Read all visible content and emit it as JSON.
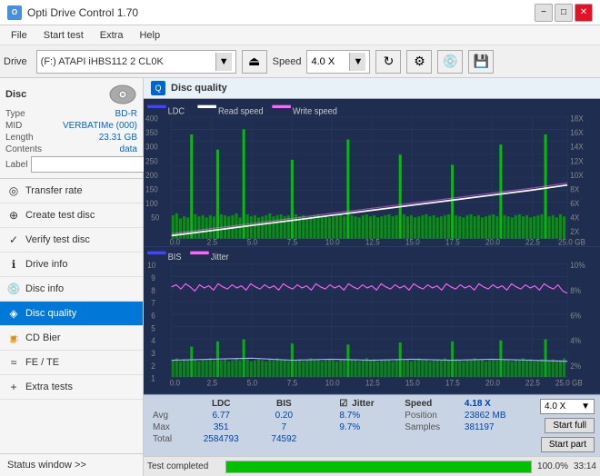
{
  "titleBar": {
    "title": "Opti Drive Control 1.70",
    "icon": "O",
    "minimizeLabel": "−",
    "maximizeLabel": "□",
    "closeLabel": "✕"
  },
  "menuBar": {
    "items": [
      "File",
      "Start test",
      "Extra",
      "Help"
    ]
  },
  "driveBar": {
    "driveLabel": "Drive",
    "driveValue": "(F:)  ATAPI iHBS112  2 CL0K",
    "speedLabel": "Speed",
    "speedValue": "4.0 X"
  },
  "disc": {
    "header": "Disc",
    "typeLabel": "Type",
    "typeValue": "BD-R",
    "midLabel": "MID",
    "midValue": "VERBATIMe (000)",
    "lengthLabel": "Length",
    "lengthValue": "23.31 GB",
    "contentsLabel": "Contents",
    "contentsValue": "data",
    "labelLabel": "Label",
    "labelValue": ""
  },
  "nav": {
    "items": [
      {
        "id": "transfer-rate",
        "label": "Transfer rate",
        "icon": "◎"
      },
      {
        "id": "create-test-disc",
        "label": "Create test disc",
        "icon": "⊕"
      },
      {
        "id": "verify-test-disc",
        "label": "Verify test disc",
        "icon": "✓"
      },
      {
        "id": "drive-info",
        "label": "Drive info",
        "icon": "ℹ"
      },
      {
        "id": "disc-info",
        "label": "Disc info",
        "icon": "💿"
      },
      {
        "id": "disc-quality",
        "label": "Disc quality",
        "icon": "◈",
        "active": true
      },
      {
        "id": "cd-bier",
        "label": "CD Bier",
        "icon": "🍺"
      },
      {
        "id": "fe-te",
        "label": "FE / TE",
        "icon": "≈"
      },
      {
        "id": "extra-tests",
        "label": "Extra tests",
        "icon": "+"
      }
    ],
    "statusWindow": "Status window >>"
  },
  "discQuality": {
    "title": "Disc quality",
    "topChart": {
      "legend": [
        {
          "label": "LDC",
          "color": "#0000ff"
        },
        {
          "label": "Read speed",
          "color": "#ffffff"
        },
        {
          "label": "Write speed",
          "color": "#ff44ff"
        }
      ],
      "yAxisMax": 400,
      "yAxisLabels": [
        "400",
        "350",
        "300",
        "250",
        "200",
        "150",
        "100",
        "50"
      ],
      "yAxisRight": [
        "18X",
        "16X",
        "14X",
        "12X",
        "10X",
        "8X",
        "6X",
        "4X",
        "2X"
      ],
      "xAxisLabels": [
        "0.0",
        "2.5",
        "5.0",
        "7.5",
        "10.0",
        "12.5",
        "15.0",
        "17.5",
        "20.0",
        "22.5",
        "25.0 GB"
      ]
    },
    "bottomChart": {
      "legend": [
        {
          "label": "BIS",
          "color": "#0000ff"
        },
        {
          "label": "Jitter",
          "color": "#ff44ff"
        }
      ],
      "yAxisMax": 10,
      "yAxisLabels": [
        "10",
        "9",
        "8",
        "7",
        "6",
        "5",
        "4",
        "3",
        "2",
        "1"
      ],
      "yAxisRight": [
        "10%",
        "8%",
        "6%",
        "4%",
        "2%"
      ],
      "xAxisLabels": [
        "0.0",
        "2.5",
        "5.0",
        "7.5",
        "10.0",
        "12.5",
        "15.0",
        "17.5",
        "20.0",
        "22.5",
        "25.0 GB"
      ]
    }
  },
  "stats": {
    "headers": [
      "",
      "LDC",
      "BIS",
      "",
      "Jitter",
      "Speed",
      "",
      ""
    ],
    "rows": [
      {
        "label": "Avg",
        "ldc": "6.77",
        "bis": "0.20",
        "jitter": "8.7%"
      },
      {
        "label": "Max",
        "ldc": "351",
        "bis": "7",
        "jitter": "9.7%"
      },
      {
        "label": "Total",
        "ldc": "2584793",
        "bis": "74592",
        "jitter": ""
      }
    ],
    "jitterChecked": true,
    "jitterLabel": "Jitter",
    "speedLabel": "Speed",
    "speedValue": "4.18 X",
    "speedSelectValue": "4.0 X",
    "positionLabel": "Position",
    "positionValue": "23862 MB",
    "samplesLabel": "Samples",
    "samplesValue": "381197",
    "startFullLabel": "Start full",
    "startPartLabel": "Start part"
  },
  "footer": {
    "statusText": "Test completed",
    "progressPercent": 100,
    "progressLabel": "100.0%",
    "time": "33:14"
  }
}
